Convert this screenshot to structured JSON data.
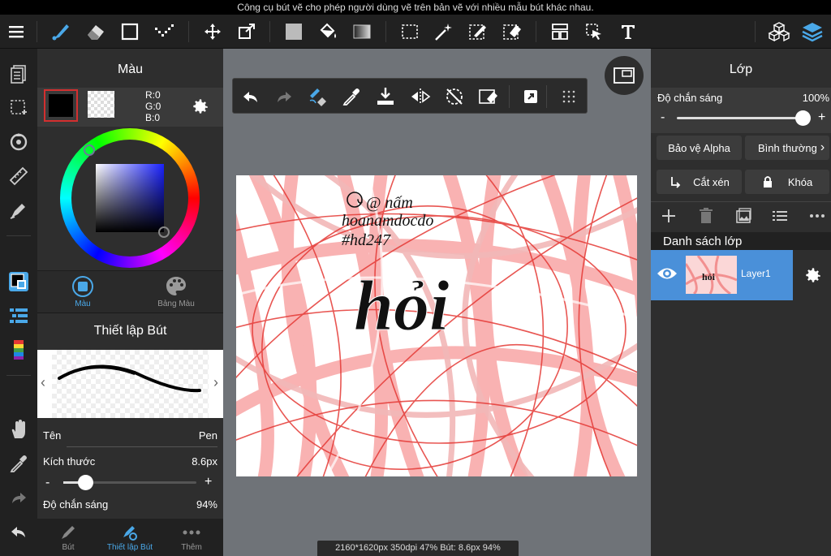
{
  "tip": "Công cụ bút vẽ cho phép người dùng vẽ trên bản vẽ với nhiều mẫu bút khác nhau.",
  "color_panel": {
    "title": "Màu",
    "rgb": {
      "r": "R:0",
      "g": "G:0",
      "b": "B:0"
    },
    "tab_color": "Màu",
    "tab_palette": "Bảng Màu",
    "accent": "#4a90d9"
  },
  "pen_panel": {
    "title": "Thiết lập Bút",
    "name_label": "Tên",
    "name_value": "Pen",
    "size_label": "Kích thước",
    "size_value": "8.6px",
    "opacity_label": "Độ chắn sáng",
    "opacity_value": "94%",
    "minus": "-",
    "plus": "+"
  },
  "bottom_tabs": {
    "pen": "Bút",
    "pen_settings": "Thiết lập Bút",
    "more": "Thêm"
  },
  "status": "2160*1620px 350dpi 47% Bút: 8.6px 94%",
  "layer_panel": {
    "title": "Lớp",
    "opacity_label": "Độ chắn sáng",
    "opacity_value": "100%",
    "minus": "-",
    "plus": "+",
    "protect_alpha": "Bảo vệ Alpha",
    "blend_mode": "Bình thường",
    "clip": "Cắt xén",
    "lock": "Khóa",
    "list_title": "Danh sách lớp",
    "layers": [
      {
        "name": "Layer1"
      }
    ]
  },
  "artwork": {
    "handle_line1": "@ nấm",
    "handle_line2": "hoanamdocdo",
    "handle_line3": "#hd247",
    "main_word": "hỏi"
  }
}
